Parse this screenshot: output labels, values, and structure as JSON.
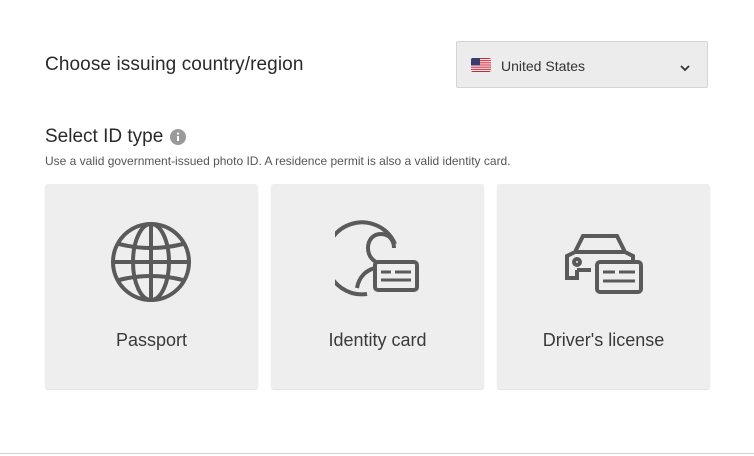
{
  "country": {
    "heading": "Choose issuing country/region",
    "selected": "United States",
    "flag_icon": "us-flag-icon",
    "chevron_icon": "chevron-down-icon"
  },
  "id_type": {
    "heading": "Select ID type",
    "info_icon": "info-icon",
    "subtitle": "Use a valid government-issued photo ID. A residence permit is also a valid identity card.",
    "options": [
      {
        "label": "Passport",
        "icon": "globe-icon"
      },
      {
        "label": "Identity card",
        "icon": "identity-card-icon"
      },
      {
        "label": "Driver's license",
        "icon": "car-license-icon"
      }
    ]
  },
  "colors": {
    "card_bg": "#eeeeee",
    "select_bg": "#ececec",
    "icon_stroke": "#5a5a5a",
    "text": "#2b2b2b"
  }
}
